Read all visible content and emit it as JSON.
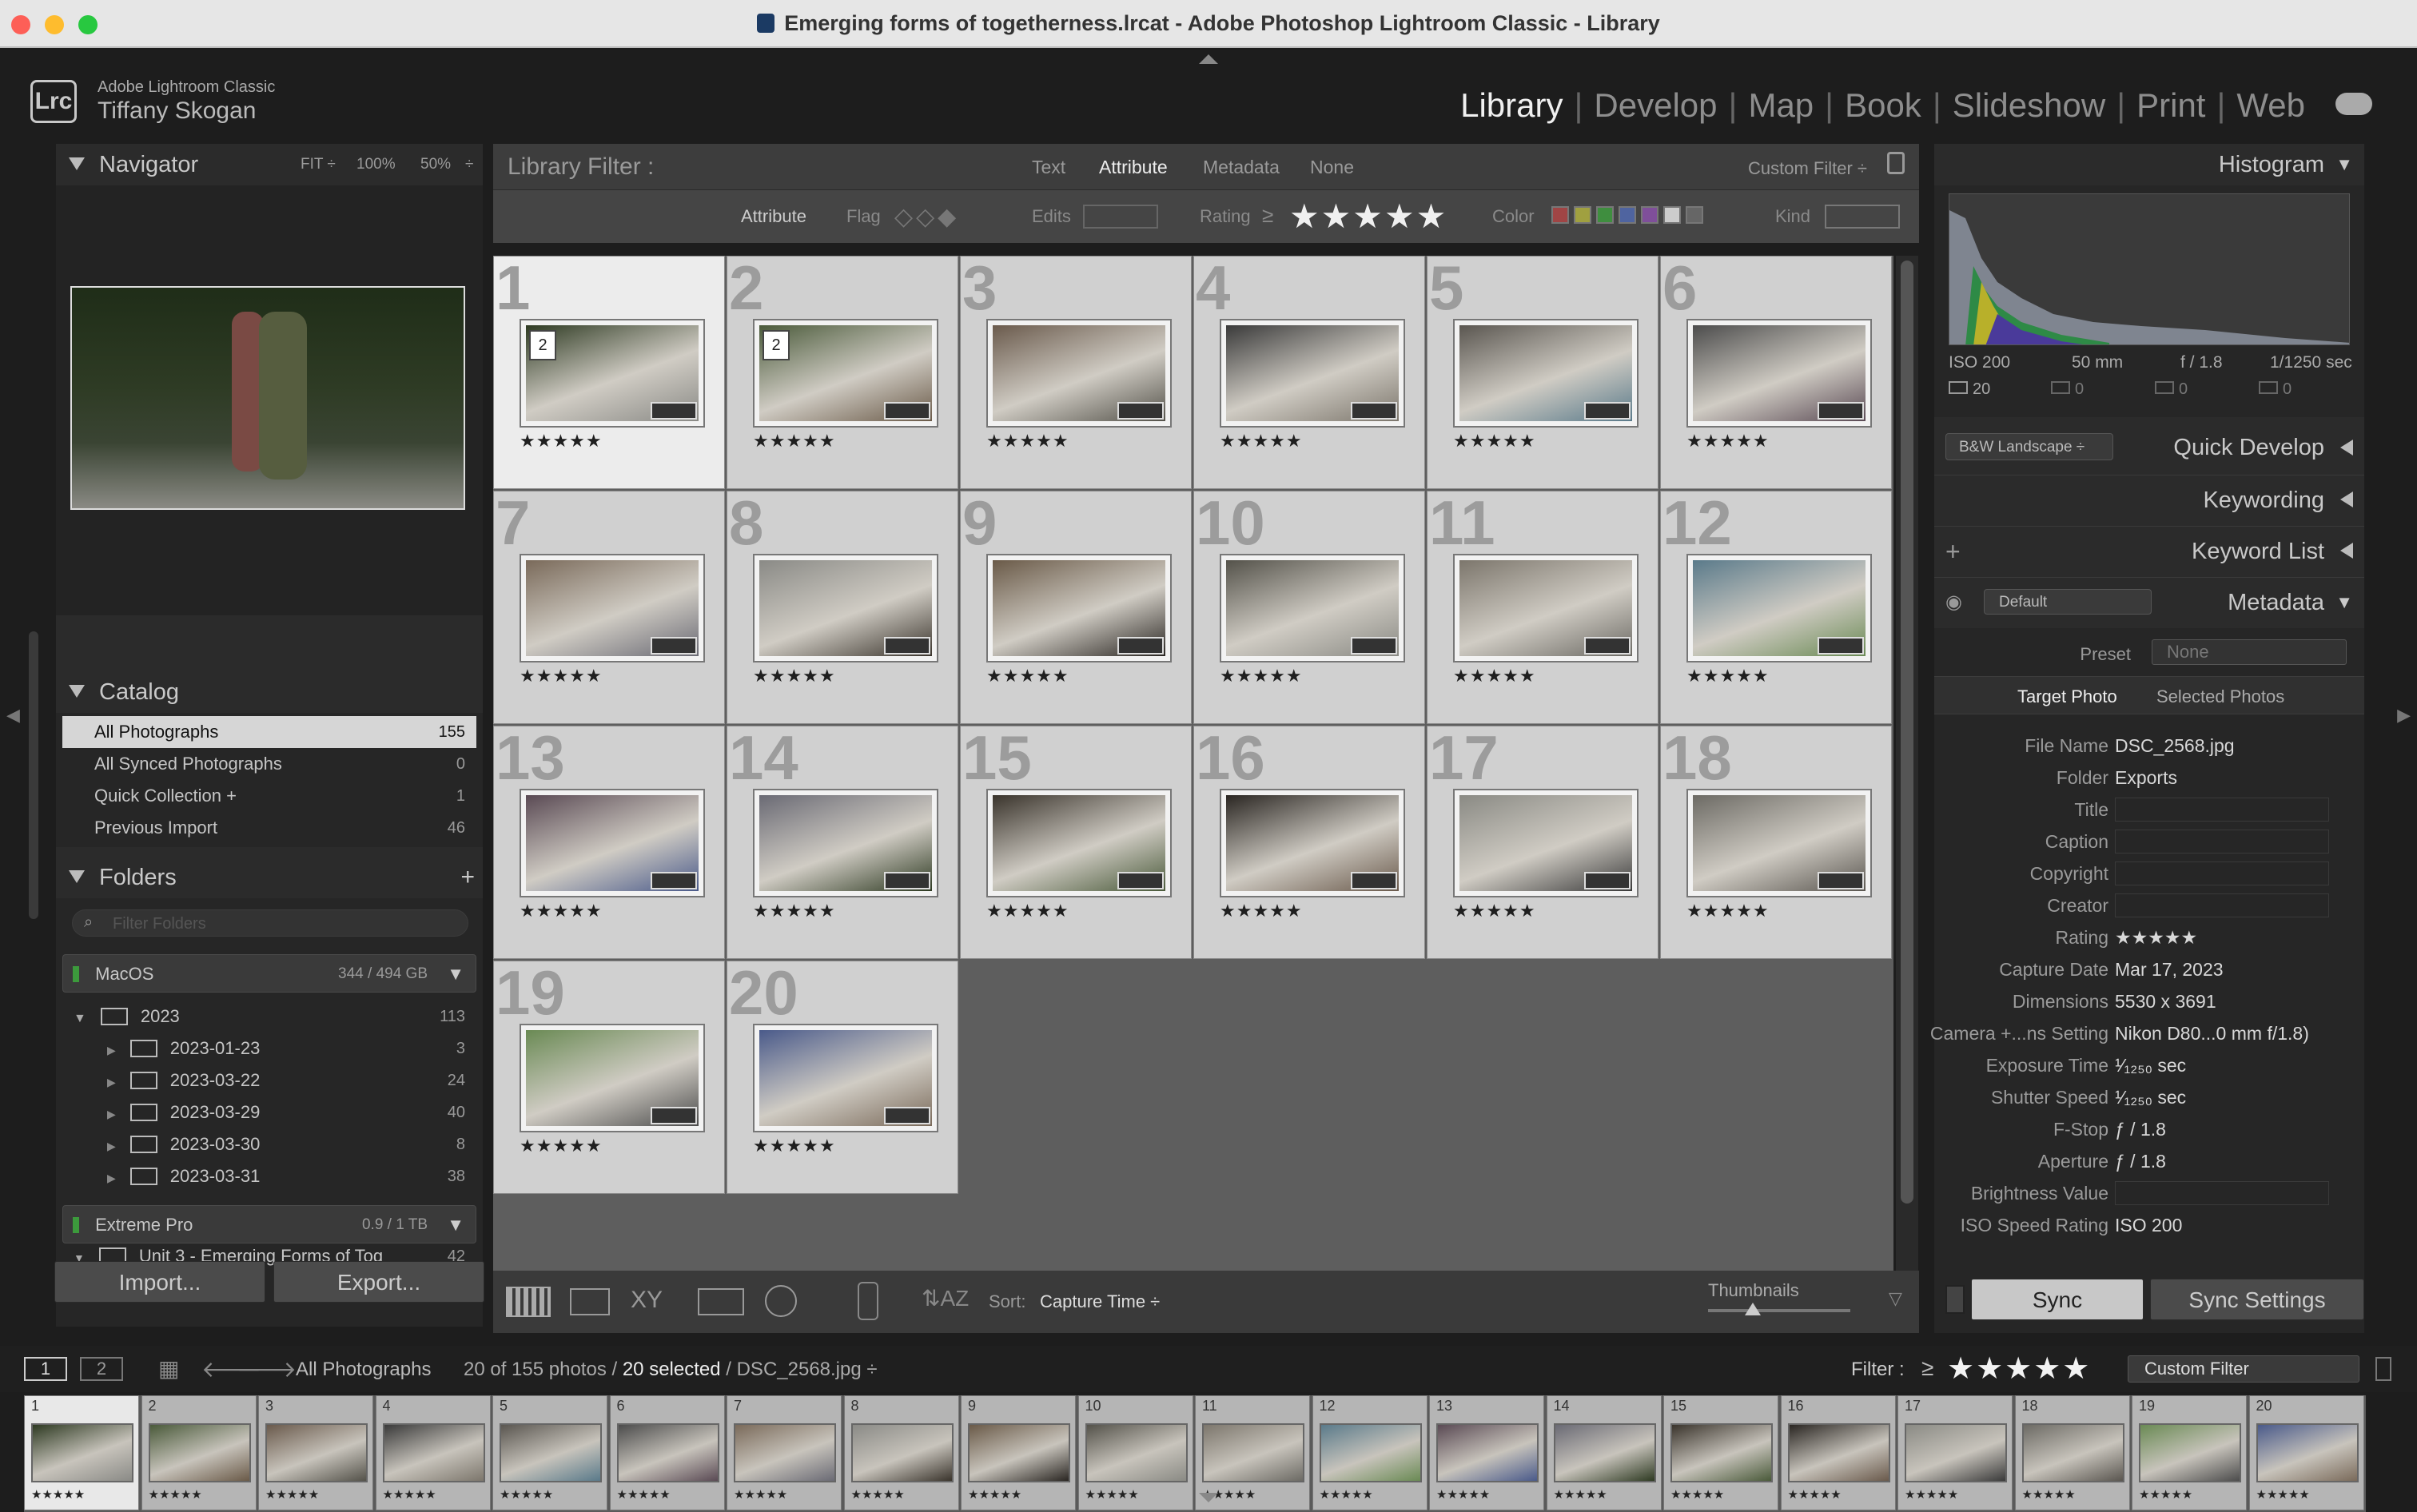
{
  "window": {
    "title": "Emerging forms of togetherness.lrcat - Adobe Photoshop Lightroom Classic - Library"
  },
  "identity": {
    "logo": "Lrc",
    "app": "Adobe Lightroom Classic",
    "user": "Tiffany Skogan"
  },
  "modules": [
    "Library",
    "Develop",
    "Map",
    "Book",
    "Slideshow",
    "Print",
    "Web"
  ],
  "navigator": {
    "title": "Navigator",
    "zoom": [
      "FIT ÷",
      "100%",
      "50%",
      "÷"
    ]
  },
  "catalog": {
    "title": "Catalog",
    "items": [
      {
        "label": "All Photographs",
        "count": "155"
      },
      {
        "label": "All Synced Photographs",
        "count": "0"
      },
      {
        "label": "Quick Collection +",
        "count": "1"
      },
      {
        "label": "Previous Import",
        "count": "46"
      }
    ]
  },
  "folders": {
    "title": "Folders",
    "search_placeholder": "Filter Folders",
    "volume1": {
      "name": "MacOS",
      "size": "344 / 494 GB"
    },
    "items": [
      {
        "label": "2023",
        "count": "113"
      },
      {
        "label": "2023-01-23",
        "count": "3"
      },
      {
        "label": "2023-03-22",
        "count": "24"
      },
      {
        "label": "2023-03-29",
        "count": "40"
      },
      {
        "label": "2023-03-30",
        "count": "8"
      },
      {
        "label": "2023-03-31",
        "count": "38"
      }
    ],
    "volume2": {
      "name": "Extreme Pro",
      "size": "0.9 / 1 TB"
    },
    "subitem": {
      "label": "Unit 3 - Emerging Forms of Tog",
      "count": "42"
    }
  },
  "left_buttons": {
    "import": "Import...",
    "export": "Export..."
  },
  "filter_bar": {
    "label": "Library Filter :",
    "tabs": [
      "Text",
      "Attribute",
      "Metadata",
      "None"
    ],
    "preset": "Custom Filter ÷",
    "attr": {
      "label": "Attribute",
      "flag": "Flag",
      "edits": "Edits",
      "rating": "Rating",
      "ge": "≥",
      "stars": "★★★★★",
      "color": "Color",
      "kind": "Kind"
    }
  },
  "grid": {
    "cells": [
      {
        "n": "1",
        "stack": "2"
      },
      {
        "n": "2",
        "stack": "2"
      },
      {
        "n": "3"
      },
      {
        "n": "4"
      },
      {
        "n": "5"
      },
      {
        "n": "6"
      },
      {
        "n": "7"
      },
      {
        "n": "8"
      },
      {
        "n": "9"
      },
      {
        "n": "10"
      },
      {
        "n": "11"
      },
      {
        "n": "12"
      },
      {
        "n": "13"
      },
      {
        "n": "14"
      },
      {
        "n": "15"
      },
      {
        "n": "16"
      },
      {
        "n": "17"
      },
      {
        "n": "18"
      },
      {
        "n": "19"
      },
      {
        "n": "20"
      }
    ],
    "stars": "★★★★★"
  },
  "toolbar": {
    "sort_label": "Sort:",
    "sort_value": "Capture Time ÷",
    "thumbnails": "Thumbnails"
  },
  "histogram": {
    "title": "Histogram",
    "iso": "ISO 200",
    "focal": "50 mm",
    "fstop": "f / 1.8",
    "shutter": "1/1250 sec",
    "counts": [
      "20",
      "0",
      "0",
      "0"
    ]
  },
  "quick_develop": {
    "title": "Quick Develop",
    "preset": "B&W Landscape ÷"
  },
  "keywording": {
    "title": "Keywording"
  },
  "keyword_list": {
    "title": "Keyword List",
    "add": "+"
  },
  "metadata": {
    "title": "Metadata",
    "preset_sel": "Default",
    "preset_label": "Preset",
    "preset_value": "None",
    "tabs": [
      "Target Photo",
      "Selected Photos"
    ],
    "fields": [
      {
        "k": "File Name",
        "v": "DSC_2568.jpg"
      },
      {
        "k": "Folder",
        "v": "Exports"
      },
      {
        "k": "Title",
        "v": ""
      },
      {
        "k": "Caption",
        "v": ""
      },
      {
        "k": "Copyright",
        "v": ""
      },
      {
        "k": "Creator",
        "v": ""
      },
      {
        "k": "Rating",
        "v": "★★★★★"
      },
      {
        "k": "Capture Date",
        "v": "Mar 17, 2023"
      },
      {
        "k": "Dimensions",
        "v": "5530 x 3691"
      },
      {
        "k": "Camera +...ns Setting",
        "v": "Nikon D80...0 mm f/1.8)"
      },
      {
        "k": "Exposure Time",
        "v": "¹⁄₁₂₅₀ sec"
      },
      {
        "k": "Shutter Speed",
        "v": "¹⁄₁₂₅₀ sec"
      },
      {
        "k": "F-Stop",
        "v": "ƒ / 1.8"
      },
      {
        "k": "Aperture",
        "v": "ƒ / 1.8"
      },
      {
        "k": "Brightness Value",
        "v": ""
      },
      {
        "k": "ISO Speed Rating",
        "v": "ISO 200"
      }
    ]
  },
  "sync": {
    "sync": "Sync",
    "settings": "Sync Settings"
  },
  "filmbar": {
    "pages": [
      "1",
      "2"
    ],
    "source": "All Photographs",
    "count": "20 of 155 photos /",
    "selected": "20 selected",
    "file": "/ DSC_2568.jpg ÷",
    "filter_label": "Filter :",
    "ge": "≥",
    "stars": "★★★★★",
    "filter_value": "Custom Filter"
  },
  "filmstrip": {
    "stars": "★★★★★",
    "n": [
      "1",
      "2",
      "3",
      "4",
      "5",
      "6",
      "7",
      "8",
      "9",
      "10",
      "11",
      "12",
      "13",
      "14",
      "15",
      "16",
      "17",
      "18",
      "19",
      "20"
    ]
  }
}
